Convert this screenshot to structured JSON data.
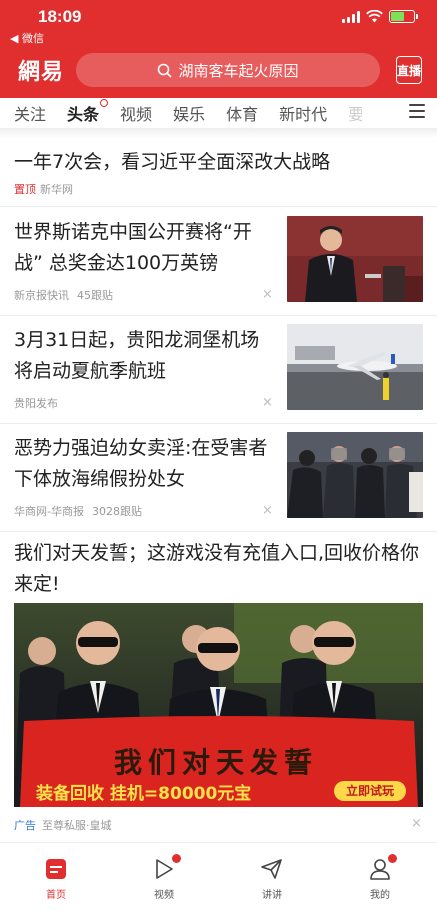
{
  "status_bar": {
    "time": "18:09",
    "back_app": "◀ 微信"
  },
  "header": {
    "logo": "網易",
    "search_placeholder": "湖南客车起火原因",
    "live_label": "直播"
  },
  "tabs": [
    {
      "label": "关注"
    },
    {
      "label": "头条",
      "active": true,
      "dot": true
    },
    {
      "label": "视频"
    },
    {
      "label": "娱乐"
    },
    {
      "label": "体育"
    },
    {
      "label": "新时代"
    },
    {
      "label": "要"
    }
  ],
  "top_story": {
    "title": "一年7次会，看习近平全面深改大战略",
    "pin_label": "置顶",
    "source": "新华网"
  },
  "news": [
    {
      "title": "世界斯诺克中国公开赛将“开战” 总奖金达100万英镑",
      "source": "新京报快讯",
      "follows": "45跟贴",
      "close": "×"
    },
    {
      "title": "3月31日起，贵阳龙洞堡机场将启动夏航季航班",
      "source": "贵阳发布",
      "follows": "",
      "close": "×"
    },
    {
      "title": "恶势力强迫幼女卖淫:在受害者下体放海绵假扮处女",
      "source": "华商网-华商报",
      "follows": "3028跟贴",
      "close": "×"
    }
  ],
  "ad": {
    "title": "我们对天发誓；这游戏没有充值入口,回收价格你来定!",
    "banner_main": "我们对天发誓",
    "banner_sub": "装备回收 挂机=80000元宝",
    "banner_cta": "立即试玩",
    "label": "广告",
    "source": "至尊私服·皇城",
    "close": "×"
  },
  "bottom_nav": [
    {
      "label": "首页",
      "active": true
    },
    {
      "label": "视频",
      "dot": true
    },
    {
      "label": "讲讲"
    },
    {
      "label": "我的",
      "dot": true
    }
  ],
  "colors": {
    "brand_red": "#e12f2f",
    "ad_blue": "#2f7bd8"
  }
}
